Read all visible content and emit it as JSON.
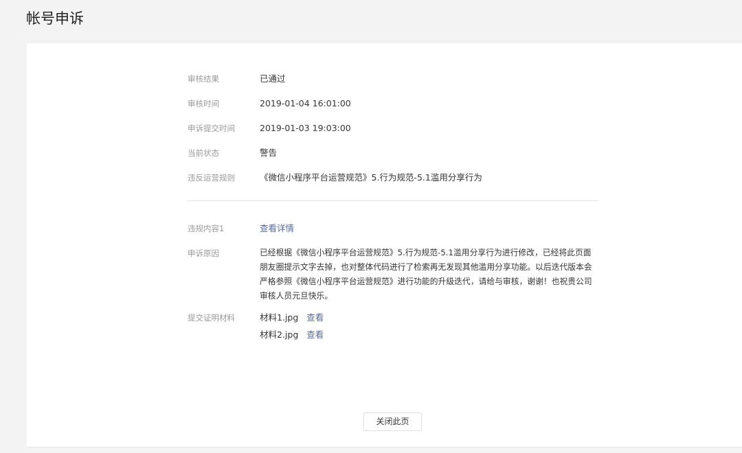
{
  "page": {
    "title": "帐号申诉"
  },
  "details": {
    "result": {
      "label": "审核结果",
      "value": "已通过"
    },
    "review_time": {
      "label": "审核时间",
      "value": "2019-01-04 16:01:00"
    },
    "submit_time": {
      "label": "申诉提交时间",
      "value": "2019-01-03 19:03:00"
    },
    "status": {
      "label": "当前状态",
      "value": "警告"
    },
    "rule": {
      "label": "违反运营规则",
      "value": "《微信小程序平台运营规范》5.行为规范-5.1滥用分享行为"
    }
  },
  "violation": {
    "content": {
      "label": "违规内容1",
      "link": "查看详情"
    },
    "reason": {
      "label": "申诉原因",
      "text": "已经根据《微信小程序平台运营规范》5.行为规范-5.1滥用分享行为进行修改，已经将此页面朋友圈提示文字去掉，也对整体代码进行了检索再无发现其他滥用分享功能。以后迭代版本会严格参照《微信小程序平台运营规范》进行功能的升级迭代，请给与审核，谢谢！也祝贵公司审核人员元旦快乐。"
    },
    "materials": {
      "label": "提交证明材料",
      "files": [
        {
          "name": "材料1.jpg",
          "action": "查看"
        },
        {
          "name": "材料2.jpg",
          "action": "查看"
        }
      ]
    }
  },
  "footer": {
    "close_label": "关闭此页"
  },
  "colors": {
    "approved": "#1aad19",
    "link": "#576b95"
  }
}
